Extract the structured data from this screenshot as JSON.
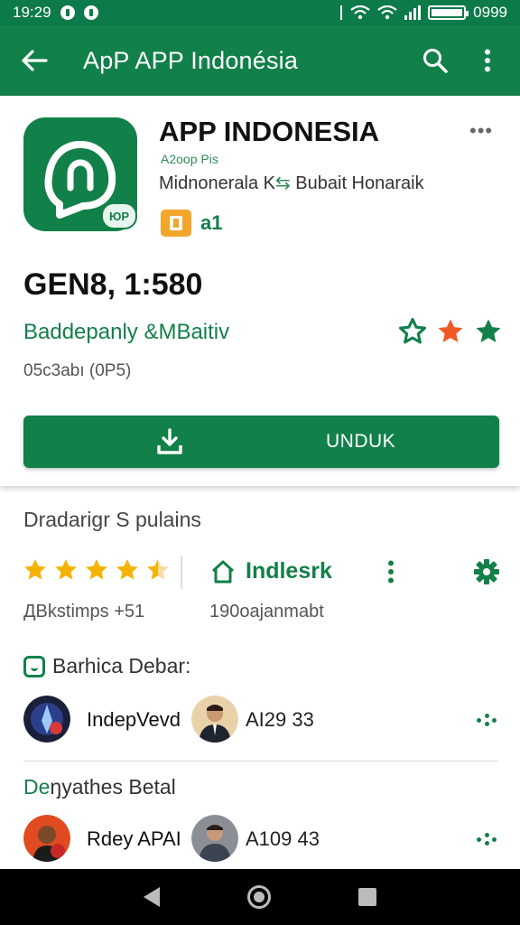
{
  "status_bar": {
    "time": "19:29",
    "battery": "0999"
  },
  "app_bar": {
    "title": "ApP APP Indonésia"
  },
  "header": {
    "app_name": "APP INDONESIA",
    "icon_badge": "ЮP",
    "dev_sub": "A2oop Pis",
    "dev_line_a": "Midnonerala K",
    "dev_line_swap": "⇆",
    "dev_line_b": " Bubait Honaraik",
    "age_rating": "a1",
    "stat": "GEN8, 1:580",
    "developer_link": "Baddepanly &MBaitiv",
    "meta": "05c3abı (0P5)",
    "install_label": "UNDUK"
  },
  "ratings_section": {
    "title": "Dradarigr S pulains",
    "follow_label": "Indlesrk",
    "meta_left": "ДBkstimps +51",
    "meta_right": "190oajanmabt",
    "rating": 4.5
  },
  "reviews": {
    "heading": "Barhica Debar:",
    "row1": {
      "name": "IndepVevd",
      "value": "AI29 33"
    },
    "heading2_a": "De",
    "heading2_b": "ŋyathes  Betal",
    "row2": {
      "name": "Rdey APAI",
      "value": "A109 43"
    }
  },
  "colors": {
    "primary": "#128049",
    "star": "#f5b301",
    "accent_star": "#ef5a24"
  }
}
